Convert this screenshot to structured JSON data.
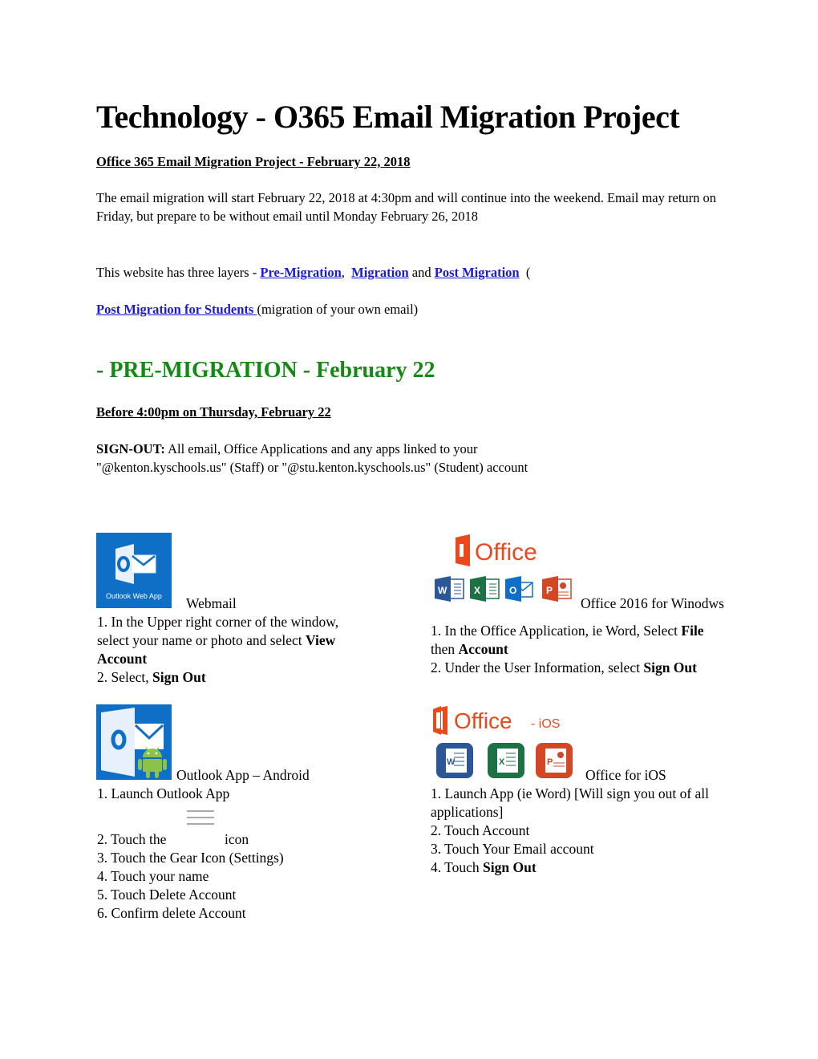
{
  "page": {
    "title": "Technology - O365 Email Migration Project",
    "subtitle": "Office 365 Email Migration Project - February 22, 2018",
    "intro": "The email migration will start February 22, 2018 at 4:30pm and will continue into the weekend.  Email may return on Friday, but prepare to be without email until Monday February 26, 2018",
    "layers": {
      "prefix": "This website has three layers - ",
      "link_pre_migration": " Pre-Migration",
      "sep1": ",  ",
      "link_migration": "Migration",
      "sep2": " and ",
      "link_post_migration": "Post Migration",
      "suffix": "  ("
    },
    "students": {
      "link": "Post Migration for Students ",
      "suffix": "(migration of your own email)"
    }
  },
  "section": {
    "heading": "- PRE-MIGRATION - February 22",
    "deadline": "Before 4:00pm on Thursday, February 22",
    "signout_label": "SIGN-OUT:",
    "signout_text": " All email, Office Applications and any apps linked to your",
    "signout_line2": "\"@kenton.kyschools.us\" (Staff) or \"@stu.kenton.kyschools.us\" (Student) account"
  },
  "cards": {
    "webmail": {
      "icon_label": "Outlook Web App",
      "caption": "Webmail",
      "step1_a": "1. In the Upper right corner of the window,",
      "step1_b": "select your name or photo and select ",
      "step1_bold": "View",
      "step1_c": "Account",
      "step2_a": "2. Select, ",
      "step2_bold": "Sign Out"
    },
    "office_windows": {
      "logo_text": "Office",
      "caption": "Office 2016 for Winodws",
      "step1_a": "1. In the Office Application, ie Word, Select ",
      "step1_bold": "File",
      "step1_b": "then ",
      "step1_bold2": "Account",
      "step2_a": "2. Under the User Information, select ",
      "step2_bold": "Sign Out"
    },
    "android": {
      "caption": "Outlook App – Android",
      "step1": "1. Launch Outlook App",
      "step2_a": "2. Touch the",
      "step2_b": "icon",
      "step3": "3. Touch the Gear Icon (Settings)",
      "step4": "4. Touch your name",
      "step5": "5. Touch Delete Account",
      "step6": "6. Confirm delete Account"
    },
    "ios": {
      "logo_text": "Office",
      "logo_suffix": "- iOS",
      "caption": "Office for iOS",
      "step1_a": "1. Launch App (ie Word) [Will sign you out of all",
      "step1_b": "applications]",
      "step2": "2. Touch Account",
      "step3": "3. Touch Your Email account",
      "step4_a": "4. Touch ",
      "step4_bold": "Sign Out"
    }
  },
  "colors": {
    "link": "#1a1ad6",
    "heading_green": "#148a14",
    "outlook_blue": "#0f6fc6",
    "office_orange": "#e8491d",
    "word_blue": "#2b5797",
    "excel_green": "#1e7145",
    "ppt_red": "#d24726",
    "android_green": "#8bc34a"
  }
}
